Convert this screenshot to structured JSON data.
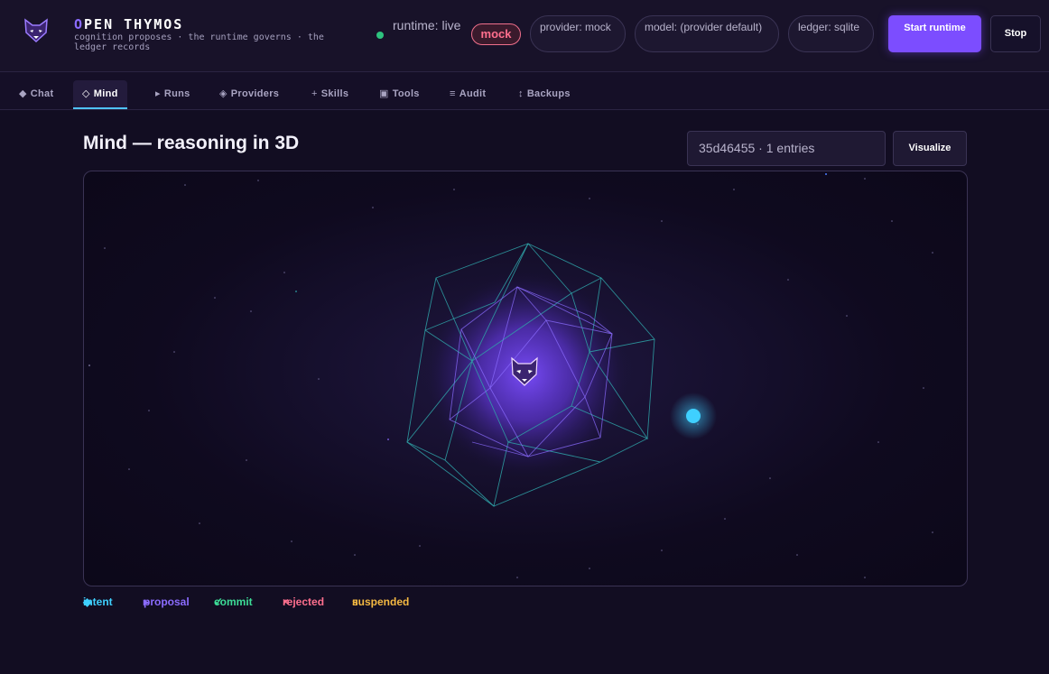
{
  "header": {
    "brand_first_letter": "O",
    "brand_rest": "PEN THYMOS",
    "tagline": "cognition proposes · the runtime governs · the ledger records",
    "runtime_status": "runtime: live",
    "runtime_status_color": "#2ec27e",
    "mock_badge": "mock",
    "provider": "provider: mock",
    "model": "model: (provider default)",
    "ledger": "ledger: sqlite",
    "start_button": "Start runtime",
    "stop_button": "Stop"
  },
  "tabs": [
    {
      "icon": "◆",
      "label": "Chat",
      "active": false
    },
    {
      "icon": "◇",
      "label": "Mind",
      "active": true
    },
    {
      "icon": "▸",
      "label": "Runs",
      "active": false
    },
    {
      "icon": "◈",
      "label": "Providers",
      "active": false
    },
    {
      "icon": "+",
      "label": "Skills",
      "active": false
    },
    {
      "icon": "▣",
      "label": "Tools",
      "active": false
    },
    {
      "icon": "≡",
      "label": "Audit",
      "active": false
    },
    {
      "icon": "↕",
      "label": "Backups",
      "active": false
    }
  ],
  "main": {
    "title": "Mind — reasoning in 3D",
    "run_selector_value": "35d46455 · 1 entries",
    "visualize_button": "Visualize"
  },
  "legend": [
    {
      "icon": "◆",
      "label": "intent",
      "color": "#3fd0ff"
    },
    {
      "icon": "▸",
      "label": "proposal",
      "color": "#8b6cff"
    },
    {
      "icon": "✓",
      "label": "commit",
      "color": "#3ddc97"
    },
    {
      "icon": "×",
      "label": "rejected",
      "color": "#ff6f8e"
    },
    {
      "icon": "ıı",
      "label": "suspended",
      "color": "#f5b942"
    }
  ],
  "colors": {
    "accent": "#7c4dff",
    "intent_node": "#3fd0ff",
    "wireframe_outer": "#2fa3a8",
    "wireframe_inner": "#8b6cff"
  }
}
